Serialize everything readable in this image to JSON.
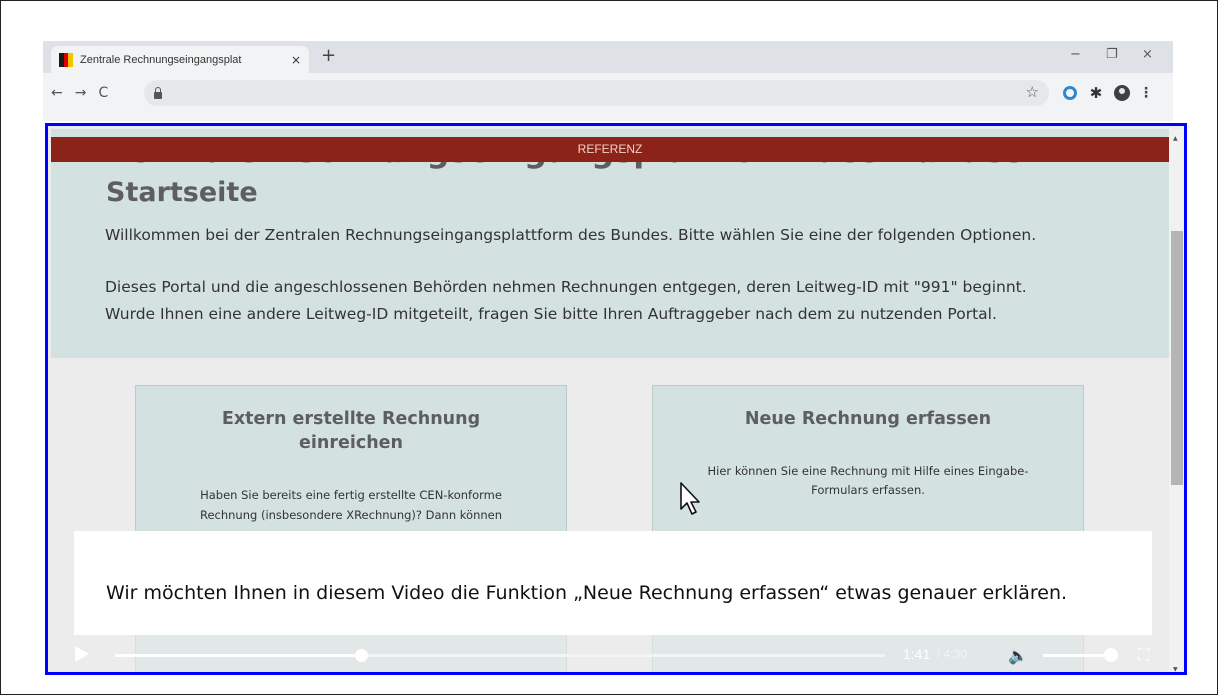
{
  "browser": {
    "tab_title": "Zentrale Rechnungseingangsplat",
    "tab_close": "×",
    "new_tab": "+",
    "window_controls": [
      "−",
      "❐",
      "×"
    ],
    "nav": [
      "←",
      "→",
      "C"
    ],
    "star": "☆",
    "menu": "⋮",
    "icons": [
      "lock-icon",
      "bookmark-star-icon",
      "extension-ring-icon",
      "puzzle-icon",
      "profile-icon",
      "menu-icon"
    ]
  },
  "page": {
    "ghost_title": "Zentrale Rechnungseingangsplattform des Bundes",
    "banner": "REFERENZ",
    "title": "Startseite",
    "welcome": "Willkommen bei der Zentralen Rechnungseingangsplattform des Bundes. Bitte wählen Sie eine der folgenden Optionen.",
    "portal_line1": "Dieses Portal und die angeschlossenen Behörden nehmen Rechnungen entgegen, deren Leitweg-ID mit \"991\" beginnt.",
    "portal_line2": "Wurde Ihnen eine andere Leitweg-ID mitgeteilt, fragen Sie bitte Ihren Auftraggeber nach dem zu nutzenden Portal.",
    "cards": [
      {
        "title_line1": "Extern erstellte Rechnung",
        "title_line2": "einreichen",
        "text_line1": "Haben Sie bereits eine fertig erstellte CEN-konforme",
        "text_line2": "Rechnung (insbesondere XRechnung)? Dann können"
      },
      {
        "title_line1": "Neue Rechnung erfassen",
        "text_line1": "Hier können Sie eine Rechnung mit Hilfe eines Eingabe-",
        "text_line2": "Formulars erfassen."
      }
    ],
    "colors": {
      "banner": "#8c2318",
      "hero": "#d4e1e1",
      "page_bg": "#ececec",
      "highlight_border": "#0000ff"
    }
  },
  "video": {
    "subtitle": "Wir möchten Ihnen in diesem Video die Funktion „Neue Rechnung erfassen“ etwas genauer erklären.",
    "current_time": "1:41",
    "duration": "/ 4:30",
    "progress": 0.32,
    "volume": 0.9,
    "icons": [
      "play-icon",
      "volume-icon",
      "fullscreen-icon"
    ]
  }
}
